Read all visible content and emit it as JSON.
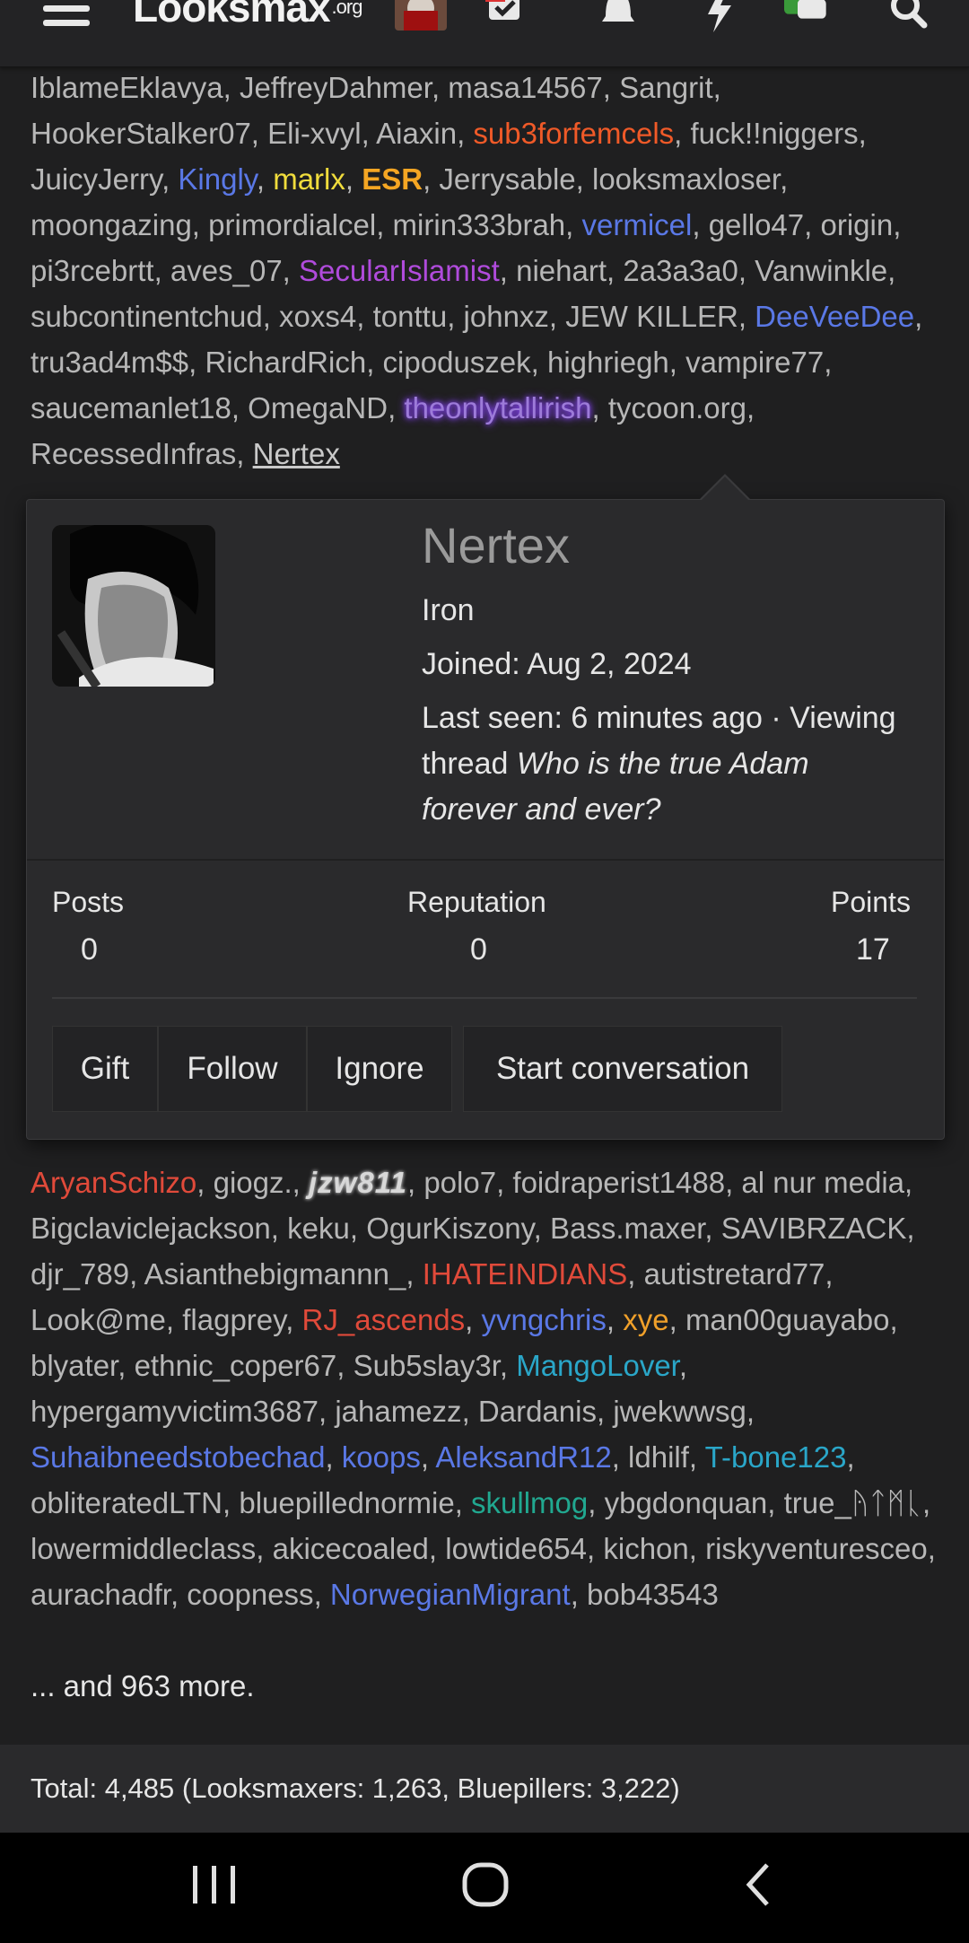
{
  "topbar": {
    "logo_text": "Looksmax",
    "logo_suffix": ".org",
    "icons": [
      "menu-icon",
      "logo",
      "user-avatar",
      "inbox-icon",
      "bell-icon",
      "lightning-icon",
      "chat-icon",
      "search-icon"
    ]
  },
  "users": [
    {
      "name": "IblameEklavya",
      "color": ""
    },
    {
      "name": "JeffreyDahmer",
      "color": ""
    },
    {
      "name": "masa14567",
      "color": ""
    },
    {
      "name": "Sangrit",
      "color": ""
    },
    {
      "name": "HookerStalker07",
      "color": ""
    },
    {
      "name": "Eli-xvyl",
      "color": ""
    },
    {
      "name": "Aiaxin",
      "color": ""
    },
    {
      "name": "sub3forfemcels",
      "color": "orange"
    },
    {
      "name": "fuck!!niggers",
      "color": ""
    },
    {
      "name": "JuicyJerry",
      "color": ""
    },
    {
      "name": "Kingly",
      "color": "blue"
    },
    {
      "name": "marlx",
      "color": "yellow"
    },
    {
      "name": "ESR",
      "color": "gold"
    },
    {
      "name": "Jerrysable",
      "color": ""
    },
    {
      "name": "looksmaxloser",
      "color": ""
    },
    {
      "name": "moongazing",
      "color": ""
    },
    {
      "name": "primordialcel",
      "color": ""
    },
    {
      "name": "mirin333brah",
      "color": ""
    },
    {
      "name": "vermicel",
      "color": "blue"
    },
    {
      "name": "gello47",
      "color": ""
    },
    {
      "name": "origin",
      "color": ""
    },
    {
      "name": "pi3rcebrtt",
      "color": ""
    },
    {
      "name": "aves_07",
      "color": ""
    },
    {
      "name": "SecularIslamist",
      "color": "purple"
    },
    {
      "name": "niehart",
      "color": ""
    },
    {
      "name": "2a3a3a0",
      "color": ""
    },
    {
      "name": "Vanwinkle",
      "color": ""
    },
    {
      "name": "subcontinentchud",
      "color": ""
    },
    {
      "name": "xoxs4",
      "color": ""
    },
    {
      "name": "tonttu",
      "color": ""
    },
    {
      "name": "johnxz",
      "color": ""
    },
    {
      "name": "JEW KILLER",
      "color": ""
    },
    {
      "name": "DeeVeeDee",
      "color": "blue"
    },
    {
      "name": "tru3ad4m$$",
      "color": ""
    },
    {
      "name": "RichardRich",
      "color": ""
    },
    {
      "name": "cipoduszek",
      "color": ""
    },
    {
      "name": "highriegh",
      "color": ""
    },
    {
      "name": "vampire77",
      "color": ""
    },
    {
      "name": "saucemanlet18",
      "color": ""
    },
    {
      "name": "OmegaND",
      "color": ""
    },
    {
      "name": "theonlytallirish",
      "color": "glow"
    },
    {
      "name": "tycoon.org",
      "color": ""
    },
    {
      "name": "RecessedInfras",
      "color": ""
    },
    {
      "name": "Nertex",
      "color": "underline"
    }
  ],
  "users_after": [
    {
      "name": "AryanSchizo",
      "color": "red"
    },
    {
      "name": "giogz.",
      "color": ""
    },
    {
      "name": "jzw811",
      "color": "fancy"
    },
    {
      "name": "polo7",
      "color": ""
    },
    {
      "name": "foidraperist1488",
      "color": ""
    },
    {
      "name": "al nur media",
      "color": ""
    },
    {
      "name": "Bigclaviclejackson",
      "color": ""
    },
    {
      "name": "keku",
      "color": ""
    },
    {
      "name": "OgurKiszony",
      "color": ""
    },
    {
      "name": "Bass.maxer",
      "color": ""
    },
    {
      "name": "SAVIBRZACK",
      "color": ""
    },
    {
      "name": "djr_789",
      "color": ""
    },
    {
      "name": "Asianthebigmannn_",
      "color": ""
    },
    {
      "name": "IHATEINDIANS",
      "color": "red"
    },
    {
      "name": "autistretard77",
      "color": ""
    },
    {
      "name": "Look@me",
      "color": ""
    },
    {
      "name": "flagprey",
      "color": ""
    },
    {
      "name": "RJ_ascends",
      "color": "red"
    },
    {
      "name": "yvngchris",
      "color": "blue"
    },
    {
      "name": "xye",
      "color": "amber"
    },
    {
      "name": "man00guayabo",
      "color": ""
    },
    {
      "name": "blyater",
      "color": ""
    },
    {
      "name": "ethnic_coper67",
      "color": ""
    },
    {
      "name": "Sub5slay3r",
      "color": ""
    },
    {
      "name": "MangoLover",
      "color": "cyan"
    },
    {
      "name": "hypergamyvictim3687",
      "color": ""
    },
    {
      "name": "jahamezz",
      "color": ""
    },
    {
      "name": "Dardanis",
      "color": ""
    },
    {
      "name": "jwekwwsg",
      "color": ""
    },
    {
      "name": "Suhaibneedstobechad",
      "color": "blue"
    },
    {
      "name": "koops",
      "color": "blue"
    },
    {
      "name": "AleksandR12",
      "color": "blue"
    },
    {
      "name": "ldhilf",
      "color": ""
    },
    {
      "name": "T-bone123",
      "color": "cyan"
    },
    {
      "name": "obliteratedLTN",
      "color": ""
    },
    {
      "name": "bluepillednormie",
      "color": ""
    },
    {
      "name": "skullmog",
      "color": "teal"
    },
    {
      "name": "ybgdonquan",
      "color": ""
    },
    {
      "name": "true_ᚤᛏᛗᚳ",
      "color": ""
    },
    {
      "name": "lowermiddleclass",
      "color": ""
    },
    {
      "name": "akicecoaled",
      "color": ""
    },
    {
      "name": "lowtide654",
      "color": ""
    },
    {
      "name": "kichon",
      "color": ""
    },
    {
      "name": "riskyventuresceo",
      "color": ""
    },
    {
      "name": "aurachadfr",
      "color": ""
    },
    {
      "name": "coopness",
      "color": ""
    },
    {
      "name": "NorwegianMigrant",
      "color": "blue"
    },
    {
      "name": "bob43543",
      "color": ""
    }
  ],
  "more_text": "... and 963 more.",
  "total_text": "Total: 4,485 (Looksmaxers: 1,263, Bluepillers: 3,222)",
  "popup": {
    "username": "Nertex",
    "title": "Iron",
    "joined": "Joined: Aug 2, 2024",
    "last_seen_prefix": "Last seen: 6 minutes ago · Viewing thread ",
    "last_seen_thread": "Who is the true Adam forever and ever?",
    "stats": [
      {
        "label": "Posts",
        "value": "0"
      },
      {
        "label": "Reputation",
        "value": "0"
      },
      {
        "label": "Points",
        "value": "17"
      }
    ],
    "buttons": {
      "gift": "Gift",
      "follow": "Follow",
      "ignore": "Ignore",
      "start_conversation": "Start conversation"
    }
  },
  "colors": {
    "orange": "#f05a28",
    "blue": "#5a78e6",
    "yellow": "#f0dc3c",
    "gold": "#f5a623",
    "purple": "#b04bdc",
    "cyan": "#2aa6c8",
    "teal": "#21a890",
    "red": "#e04a3a",
    "amber": "#f0a02a",
    "background": "#1f1f20",
    "popup": "#2a2a2c"
  }
}
